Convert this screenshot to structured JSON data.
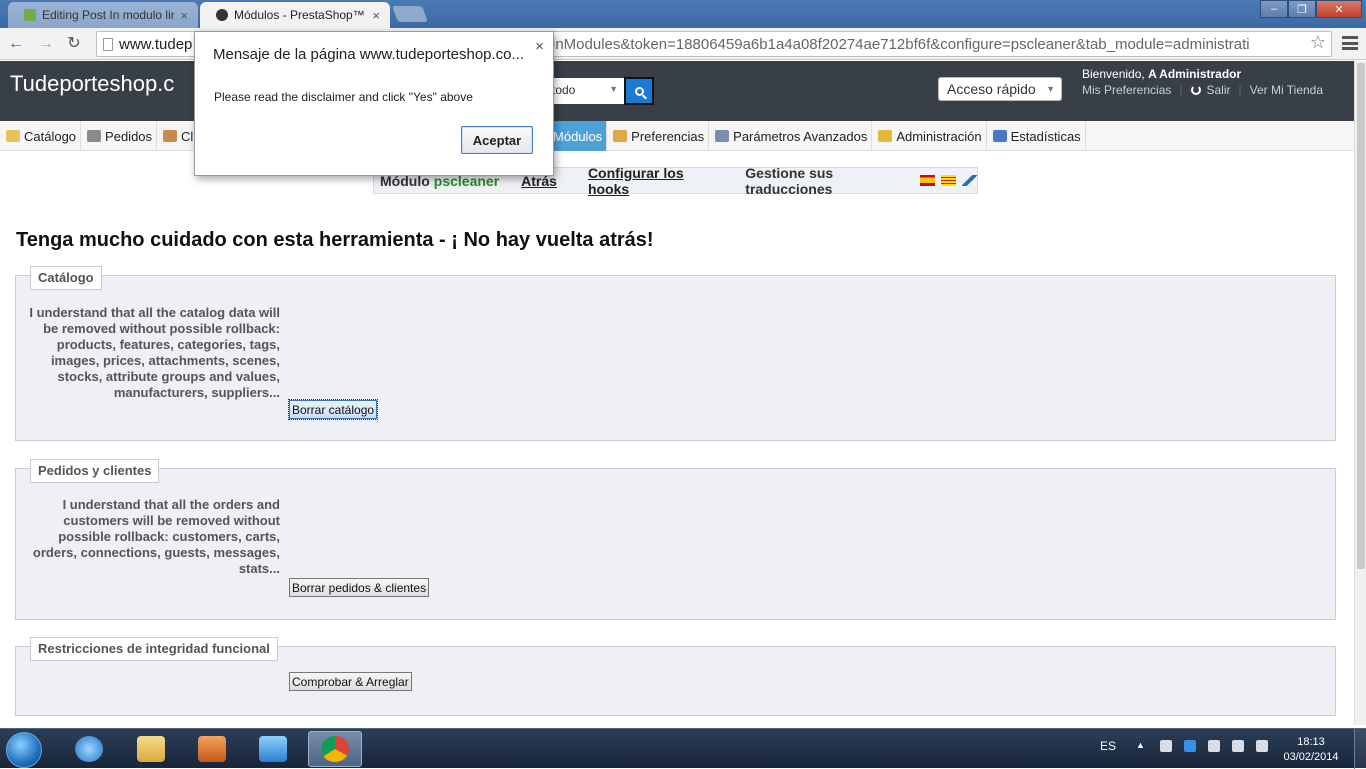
{
  "browser": {
    "tabs": [
      {
        "title": "Editing Post In modulo lin",
        "active": false
      },
      {
        "title": "Módulos - PrestaShop™",
        "active": true
      }
    ],
    "url_left": "www.tudep",
    "url_right": "inModules&token=18806459a6b1a4a08f20274ae712bf6f&configure=pscleaner&tab_module=administrati",
    "tab_close": "×",
    "win_min": "–",
    "win_max": "❐",
    "win_close": "✕"
  },
  "header": {
    "shop_name": "Tudeporteshop.c",
    "search_value": "todo",
    "quick_access": "Acceso rápido",
    "welcome_prefix": "Bienvenido,",
    "welcome_user": "A Administrador",
    "links": {
      "prefs": "Mis Preferencias",
      "logout": "Salir",
      "view_store": "Ver Mi Tienda"
    }
  },
  "nav": {
    "items": [
      {
        "label": "Catálogo",
        "icon": "folder-icon",
        "color": "#e8c25a"
      },
      {
        "label": "Pedidos",
        "icon": "cart-icon",
        "color": "#8a8a8a"
      },
      {
        "label": "Cl",
        "icon": "user-icon",
        "color": "#c98a4e"
      },
      {
        "label": "Módulos",
        "icon": "puzzle-icon",
        "color": "#6cc46c"
      },
      {
        "label": "Preferencias",
        "icon": "preferences-icon",
        "color": "#e0a840"
      },
      {
        "label": "Parámetros Avanzados",
        "icon": "wrench-icon",
        "color": "#7a8fb0"
      },
      {
        "label": "Administración",
        "icon": "key-icon",
        "color": "#e2b73a"
      },
      {
        "label": "Estadísticas",
        "icon": "stats-icon",
        "color": "#4a78c8"
      }
    ]
  },
  "module_bar": {
    "module_label": "Módulo",
    "module_name": "pscleaner",
    "back": "Atrás",
    "hooks": "Configurar los hooks",
    "translations": "Gestione sus traducciones"
  },
  "page": {
    "warning": "Tenga mucho cuidado con esta herramienta - ¡ No hay vuelta atrás!",
    "sections": {
      "catalog": {
        "legend": "Catálogo",
        "desc": "I understand that all the catalog data will be removed without possible rollback: products, features, categories, tags, images, prices, attachments, scenes, stocks, attribute groups and values, manufacturers, suppliers...",
        "button": "Borrar catálogo"
      },
      "orders": {
        "legend": "Pedidos y clientes",
        "desc": "I understand that all the orders and customers will be removed without possible rollback: customers, carts, orders, connections, guests, messages, stats...",
        "button": "Borrar pedidos & clientes"
      },
      "integrity": {
        "legend": "Restricciones de integridad funcional",
        "button": "Comprobar & Arreglar"
      }
    }
  },
  "dialog": {
    "title": "Mensaje de la página www.tudeporteshop.co...",
    "message": "Please read the disclaimer and click \"Yes\" above",
    "ok": "Aceptar",
    "close": "×"
  },
  "taskbar": {
    "lang": "ES",
    "time": "18:13",
    "date": "03/02/2014"
  }
}
